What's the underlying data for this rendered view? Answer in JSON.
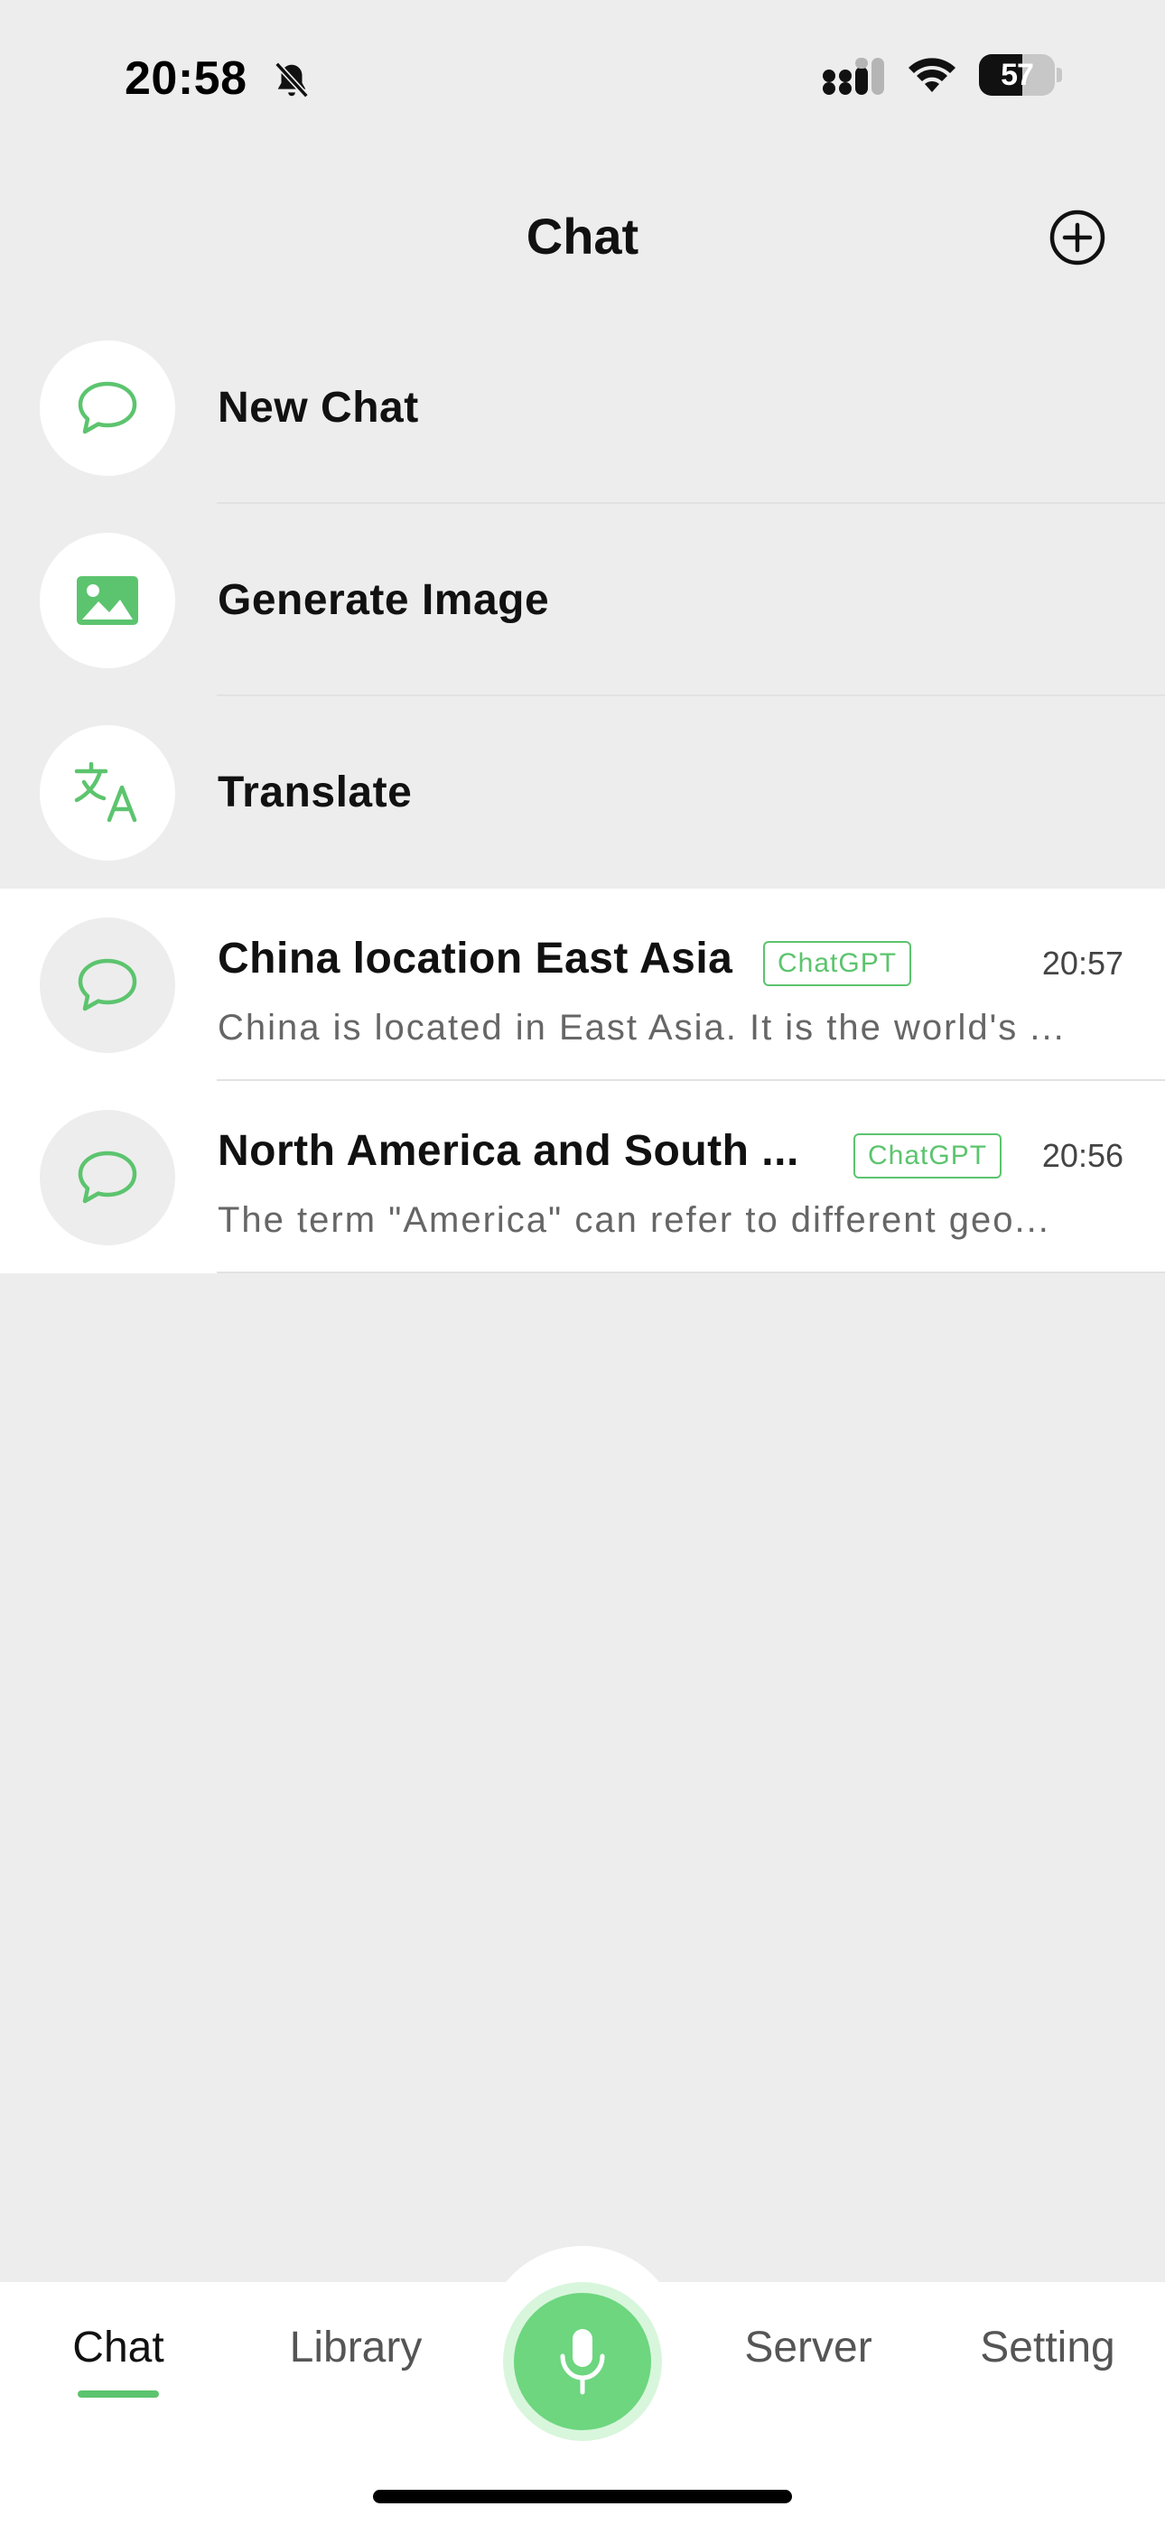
{
  "status_bar": {
    "time": "20:58",
    "battery": "57",
    "icons": [
      "bell-slash-icon",
      "cellular-signal-icon",
      "wifi-icon",
      "battery-icon"
    ]
  },
  "header": {
    "title": "Chat",
    "add_icon": "plus-circle-icon"
  },
  "actions": [
    {
      "label": "New Chat",
      "icon": "chat-bubble-icon"
    },
    {
      "label": "Generate Image",
      "icon": "image-icon"
    },
    {
      "label": "Translate",
      "icon": "translate-icon"
    }
  ],
  "conversations": [
    {
      "title": "China location East Asia",
      "badge": "ChatGPT",
      "time": "20:57",
      "preview": "China is located in East Asia. It is the world's ...",
      "icon": "chat-bubble-icon"
    },
    {
      "title": "North America and South ...",
      "badge": "ChatGPT",
      "time": "20:56",
      "preview": "The term \"America\" can refer to different geo...",
      "icon": "chat-bubble-icon"
    }
  ],
  "tabbar": {
    "tabs": [
      {
        "label": "Chat",
        "active": true
      },
      {
        "label": "Library",
        "active": false
      },
      {
        "label": "Server",
        "active": false
      },
      {
        "label": "Setting",
        "active": false
      }
    ],
    "mic_icon": "microphone-icon"
  },
  "colors": {
    "accent": "#5cc46e",
    "background": "#ededed",
    "mic": "#6dd67f"
  }
}
